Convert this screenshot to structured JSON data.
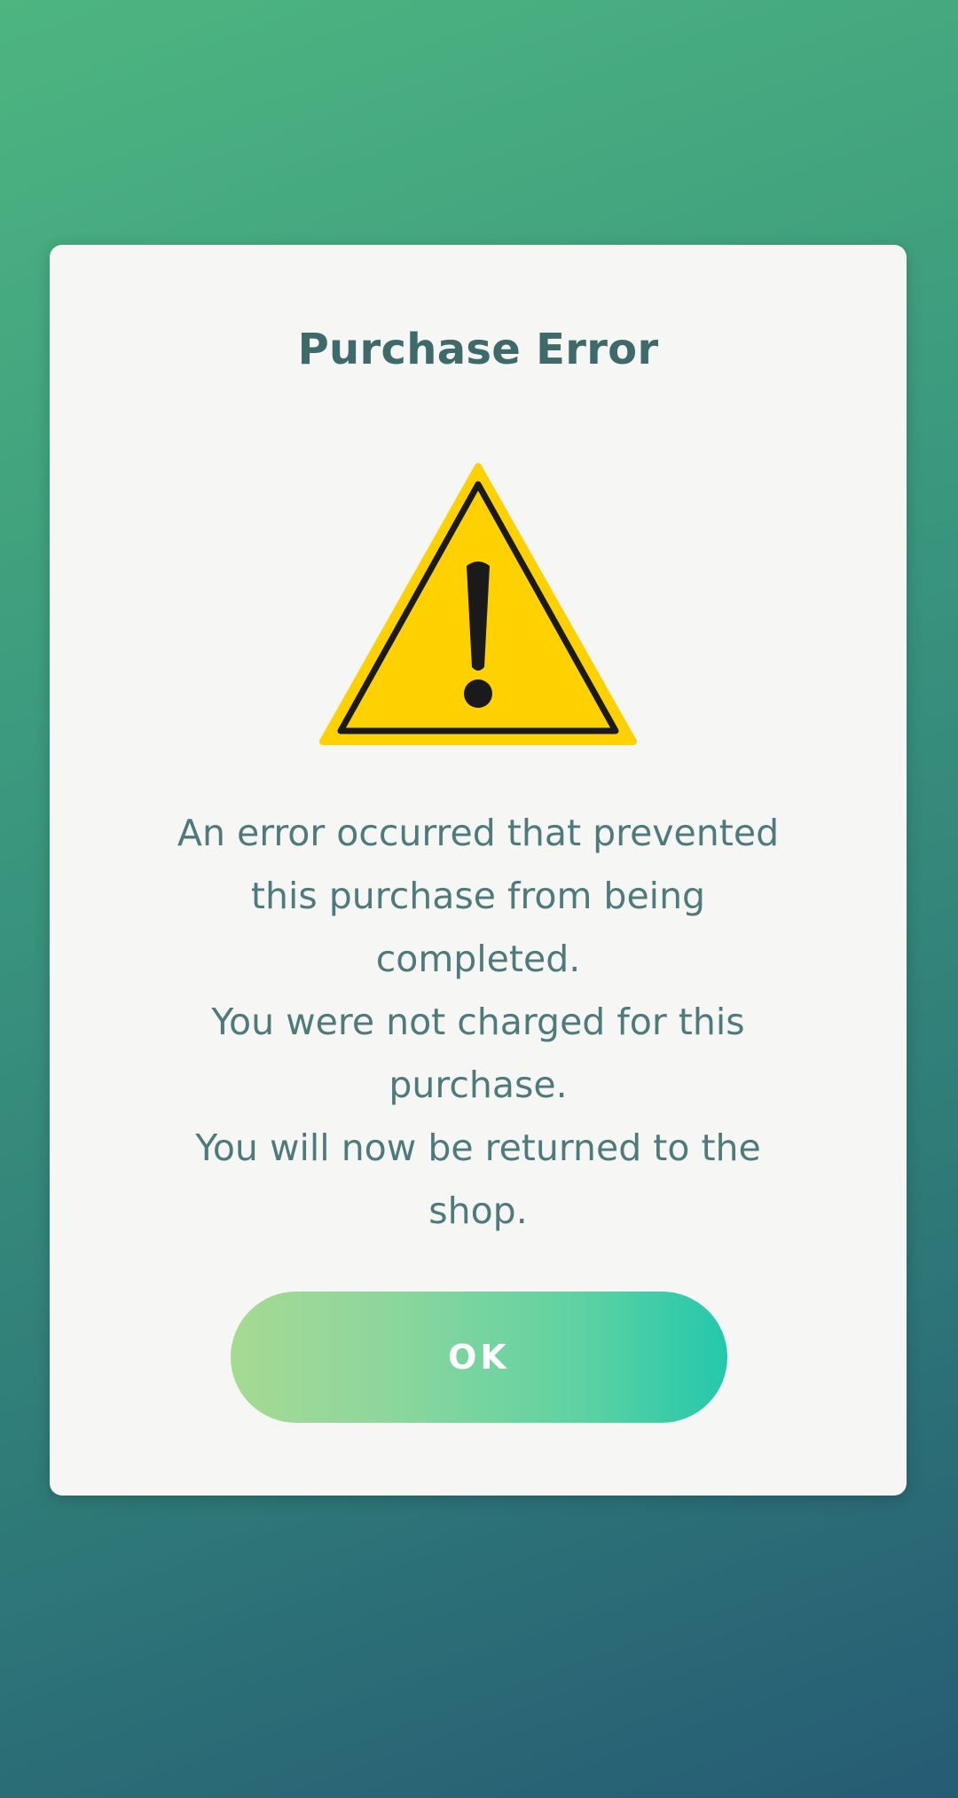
{
  "dialog": {
    "title": "Purchase Error",
    "icon": "warning-triangle-icon",
    "message_lines": [
      "An error occurred that prevented this purchase from being completed.",
      "You were not charged for this purchase.",
      "You will now be returned to the shop."
    ],
    "ok_label": "OK"
  },
  "colors": {
    "background_top": "#4db580",
    "background_bottom": "#265b74",
    "dialog_bg": "#f6f7f5",
    "title_text": "#3f6a6c",
    "body_text": "#4f7a7b",
    "warning_yellow": "#ffd100",
    "button_gradient_start": "#a6da92",
    "button_gradient_end": "#24c8ac"
  }
}
